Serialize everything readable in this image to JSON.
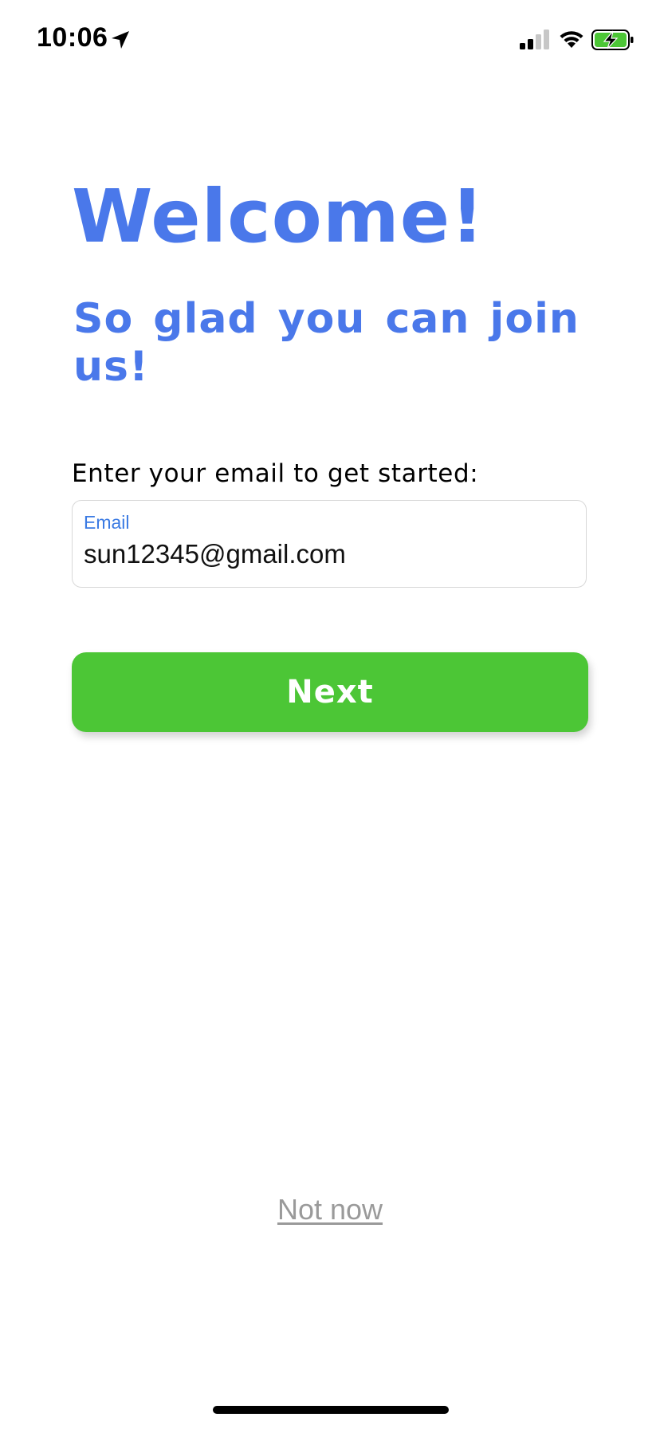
{
  "status_bar": {
    "time": "10:06",
    "icons": [
      "location-arrow-icon",
      "cellular-signal-icon",
      "wifi-icon",
      "battery-charging-icon"
    ],
    "battery_color": "#4cc636"
  },
  "header": {
    "title": "Welcome!",
    "subtitle": "So glad you can join us!"
  },
  "form": {
    "prompt": "Enter your email to get started:",
    "email_label": "Email",
    "email_value": "sun12345@gmail.com"
  },
  "actions": {
    "next_label": "Next",
    "not_now_label": "Not now"
  },
  "colors": {
    "accent": "#4a78ea",
    "button": "#4cc636",
    "label": "#3a7ae3",
    "muted": "#9a9a9a"
  }
}
